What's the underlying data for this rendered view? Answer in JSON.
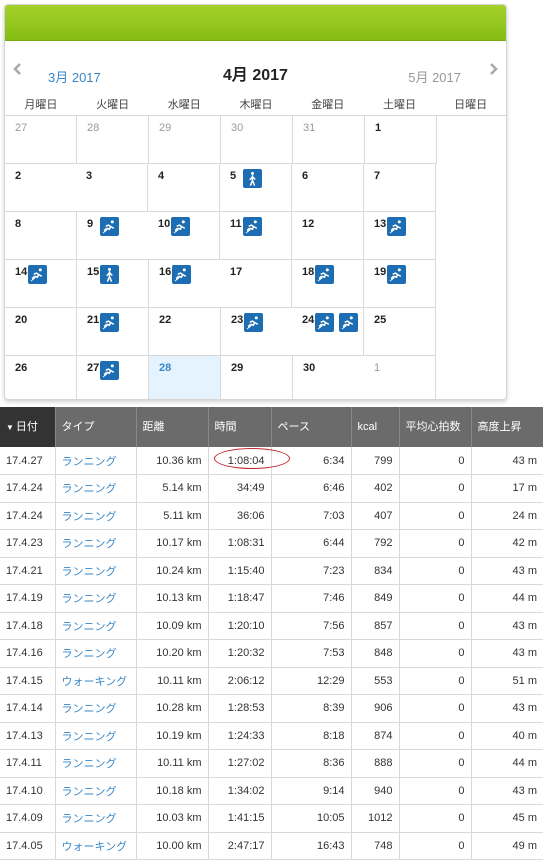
{
  "calendar": {
    "prev_month": "3月 2017",
    "current_month": "4月 2017",
    "next_month": "5月 2017",
    "weekdays": [
      "月曜日",
      "火曜日",
      "水曜日",
      "木曜日",
      "金曜日",
      "土曜日",
      "日曜日"
    ],
    "days": [
      {
        "n": "27",
        "other": true,
        "icons": []
      },
      {
        "n": "28",
        "other": true,
        "icons": []
      },
      {
        "n": "29",
        "other": true,
        "icons": []
      },
      {
        "n": "30",
        "other": true,
        "icons": []
      },
      {
        "n": "31",
        "other": true,
        "icons": []
      },
      {
        "n": "1",
        "icons": []
      },
      {
        "n": "2",
        "icons": []
      },
      {
        "n": "3",
        "icons": []
      },
      {
        "n": "4",
        "icons": []
      },
      {
        "n": "5",
        "icons": [
          "walking-icon"
        ]
      },
      {
        "n": "6",
        "icons": []
      },
      {
        "n": "7",
        "icons": []
      },
      {
        "n": "8",
        "icons": []
      },
      {
        "n": "9",
        "icons": [
          "running-icon"
        ]
      },
      {
        "n": "10",
        "icons": [
          "running-icon"
        ]
      },
      {
        "n": "11",
        "icons": [
          "running-icon"
        ]
      },
      {
        "n": "12",
        "icons": []
      },
      {
        "n": "13",
        "icons": [
          "running-icon"
        ]
      },
      {
        "n": "14",
        "icons": [
          "running-icon"
        ]
      },
      {
        "n": "15",
        "icons": [
          "walking-icon"
        ]
      },
      {
        "n": "16",
        "icons": [
          "running-icon"
        ]
      },
      {
        "n": "17",
        "icons": []
      },
      {
        "n": "18",
        "icons": [
          "running-icon"
        ]
      },
      {
        "n": "19",
        "icons": [
          "running-icon"
        ]
      },
      {
        "n": "20",
        "icons": []
      },
      {
        "n": "21",
        "icons": [
          "running-icon"
        ]
      },
      {
        "n": "22",
        "icons": []
      },
      {
        "n": "23",
        "icons": [
          "running-icon"
        ]
      },
      {
        "n": "24",
        "icons": [
          "running-icon",
          "running-icon"
        ]
      },
      {
        "n": "25",
        "icons": []
      },
      {
        "n": "26",
        "icons": []
      },
      {
        "n": "27",
        "icons": [
          "running-icon"
        ]
      },
      {
        "n": "28",
        "today": true,
        "icons": []
      },
      {
        "n": "29",
        "icons": []
      },
      {
        "n": "30",
        "icons": []
      },
      {
        "n": "1",
        "other": true,
        "icons": []
      },
      {
        "n": "2",
        "other": true,
        "icons": []
      },
      {
        "n": "3",
        "other": true,
        "icons": []
      },
      {
        "n": "4",
        "other": true,
        "icons": []
      },
      {
        "n": "5",
        "other": true,
        "icons": []
      },
      {
        "n": "6",
        "other": true,
        "icons": []
      },
      {
        "n": "7",
        "other": true,
        "icons": []
      }
    ]
  },
  "table": {
    "headers": [
      "日付",
      "タイプ",
      "距離",
      "時間",
      "ペース",
      "kcal",
      "平均心拍数",
      "高度上昇"
    ],
    "rows": [
      [
        "17.4.27",
        "ランニング",
        "10.36 km",
        "1:08:04",
        "6:34",
        "799",
        "0",
        "43 m"
      ],
      [
        "17.4.24",
        "ランニング",
        "5.14 km",
        "34:49",
        "6:46",
        "402",
        "0",
        "17 m"
      ],
      [
        "17.4.24",
        "ランニング",
        "5.11 km",
        "36:06",
        "7:03",
        "407",
        "0",
        "24 m"
      ],
      [
        "17.4.23",
        "ランニング",
        "10.17 km",
        "1:08:31",
        "6:44",
        "792",
        "0",
        "42 m"
      ],
      [
        "17.4.21",
        "ランニング",
        "10.24 km",
        "1:15:40",
        "7:23",
        "834",
        "0",
        "43 m"
      ],
      [
        "17.4.19",
        "ランニング",
        "10.13 km",
        "1:18:47",
        "7:46",
        "849",
        "0",
        "44 m"
      ],
      [
        "17.4.18",
        "ランニング",
        "10.09 km",
        "1:20:10",
        "7:56",
        "857",
        "0",
        "43 m"
      ],
      [
        "17.4.16",
        "ランニング",
        "10.20 km",
        "1:20:32",
        "7:53",
        "848",
        "0",
        "43 m"
      ],
      [
        "17.4.15",
        "ウォーキング",
        "10.11 km",
        "2:06:12",
        "12:29",
        "553",
        "0",
        "51 m"
      ],
      [
        "17.4.14",
        "ランニング",
        "10.28 km",
        "1:28:53",
        "8:39",
        "906",
        "0",
        "43 m"
      ],
      [
        "17.4.13",
        "ランニング",
        "10.19 km",
        "1:24:33",
        "8:18",
        "874",
        "0",
        "40 m"
      ],
      [
        "17.4.11",
        "ランニング",
        "10.11 km",
        "1:27:02",
        "8:36",
        "888",
        "0",
        "44 m"
      ],
      [
        "17.4.10",
        "ランニング",
        "10.18 km",
        "1:34:02",
        "9:14",
        "940",
        "0",
        "43 m"
      ],
      [
        "17.4.09",
        "ランニング",
        "10.03 km",
        "1:41:15",
        "10:05",
        "1012",
        "0",
        "45 m"
      ],
      [
        "17.4.05",
        "ウォーキング",
        "10.00 km",
        "2:47:17",
        "16:43",
        "748",
        "0",
        "49 m"
      ]
    ],
    "highlighted_cell": "1:08:04"
  },
  "colors": {
    "topbar": "#8dc21f",
    "link": "#3a87c8",
    "activity_icon": "#1d6db2",
    "today": "#e4f3fd",
    "header_bg": "#6b6b6b",
    "annotation": "#c0242c"
  }
}
